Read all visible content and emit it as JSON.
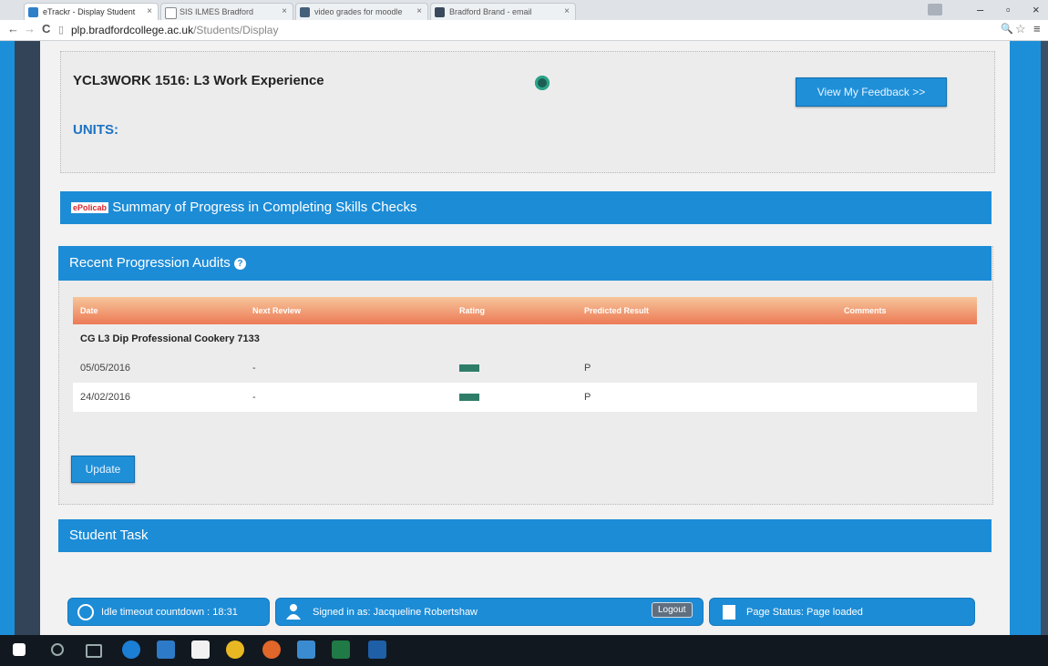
{
  "browser": {
    "tabs": [
      {
        "label": "eTrackr - Display Student",
        "active": true
      },
      {
        "label": "SIS ILMES Bradford",
        "active": false
      },
      {
        "label": "video grades for moodle",
        "active": false
      },
      {
        "label": "Bradford Brand - email",
        "active": false
      }
    ],
    "tab_close_glyph": "×",
    "window_controls": {
      "minimize": "–",
      "maximize": "▫",
      "close": "×"
    },
    "back_glyph": "←",
    "forward_glyph": "→",
    "reload_glyph": "C",
    "page_icon_glyph": "▯",
    "url_host": "plp.bradfordcollege.ac.uk",
    "url_path": "/Students/Display",
    "right_icons": {
      "zoom": "🔍",
      "star": "☆",
      "menu": "≡"
    }
  },
  "course": {
    "title": "YCL3WORK 1516: L3 Work Experience",
    "units_label": "UNITS:",
    "feedback_button": "View My Feedback >>"
  },
  "skills_bar": {
    "badge": "ePolicab",
    "label": "Summary of Progress in Completing Skills Checks"
  },
  "audits": {
    "title": "Recent Progression Audits",
    "info_glyph": "?",
    "columns": [
      "Date",
      "Next Review",
      "Rating",
      "Predicted Result",
      "Comments"
    ],
    "qualification": "CG L3 Dip Professional Cookery 7133",
    "rows": [
      {
        "date": "05/05/2016",
        "next_review": "-",
        "rating_color": "#2f7d68",
        "predicted": "P",
        "comments": ""
      },
      {
        "date": "24/02/2016",
        "next_review": "-",
        "rating_color": "#2f7d68",
        "predicted": "P",
        "comments": ""
      }
    ],
    "update_button": "Update"
  },
  "student_task": {
    "title": "Student Task"
  },
  "status": {
    "idle_text": "Idle timeout countdown : 18:31",
    "signed_in_text": "Signed in as: Jacqueline Robertshaw",
    "logout_button": "Logout",
    "page_status_text": "Page Status: Page loaded"
  },
  "taskbar": {
    "icons": [
      "windows-icon",
      "search-icon",
      "task-view-icon",
      "edge-icon",
      "store-icon",
      "file-explorer-icon",
      "chrome-icon",
      "firefox-icon",
      "people-icon",
      "excel-icon",
      "outlook-icon"
    ]
  }
}
